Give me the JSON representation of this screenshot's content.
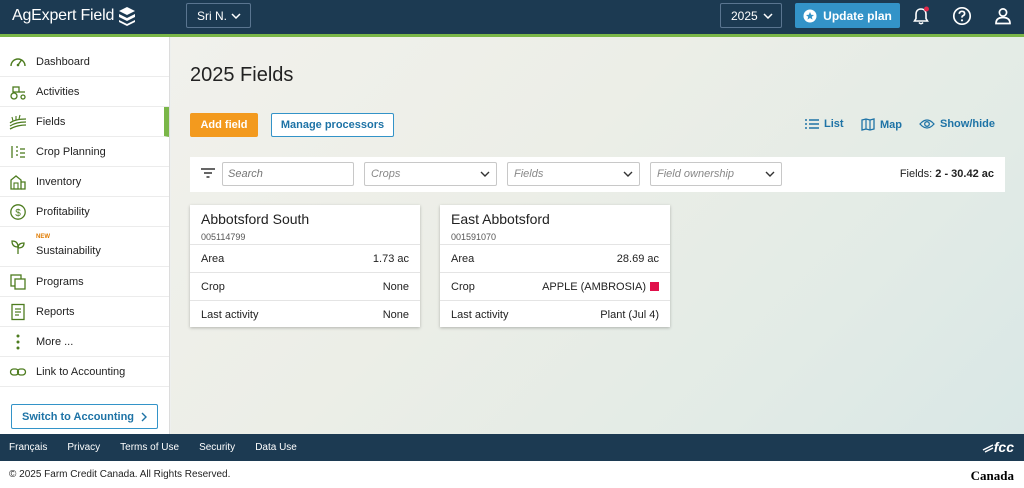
{
  "app": {
    "name": "AgExpert Field"
  },
  "header": {
    "user": "Sri N.",
    "year": "2025",
    "update_plan": "Update plan"
  },
  "sidebar": {
    "items": [
      {
        "label": "Dashboard",
        "icon": "gauge-icon"
      },
      {
        "label": "Activities",
        "icon": "tractor-icon"
      },
      {
        "label": "Fields",
        "icon": "field-rows-icon",
        "active": true
      },
      {
        "label": "Crop Planning",
        "icon": "crop-plan-icon"
      },
      {
        "label": "Inventory",
        "icon": "barn-icon"
      },
      {
        "label": "Profitability",
        "icon": "dollar-icon"
      },
      {
        "label": "Sustainability",
        "icon": "sprout-icon",
        "badge": "NEW"
      },
      {
        "label": "Programs",
        "icon": "programs-icon"
      },
      {
        "label": "Reports",
        "icon": "report-icon"
      },
      {
        "label": "More ...",
        "icon": "more-vertical-icon"
      },
      {
        "label": "Link to Accounting",
        "icon": "link-icon"
      }
    ],
    "switch_label": "Switch to Accounting"
  },
  "main": {
    "title": "2025 Fields",
    "add_field": "Add field",
    "manage_processors": "Manage processors",
    "views": {
      "list": "List",
      "map": "Map",
      "showhide": "Show/hide"
    },
    "filters": {
      "search_placeholder": "Search",
      "crops": "Crops",
      "fields": "Fields",
      "ownership": "Field ownership",
      "count_label": "Fields:",
      "count_value": "2 - 30.42 ac"
    },
    "cards": [
      {
        "name": "Abbotsford South",
        "id": "005114799",
        "area_label": "Area",
        "area": "1.73 ac",
        "crop_label": "Crop",
        "crop": "None",
        "activity_label": "Last activity",
        "activity": "None"
      },
      {
        "name": "East Abbotsford",
        "id": "001591070",
        "area_label": "Area",
        "area": "28.69 ac",
        "crop_label": "Crop",
        "crop": "APPLE (AMBROSIA)",
        "crop_color": "#e0104a",
        "activity_label": "Last activity",
        "activity": "Plant (Jul 4)"
      }
    ]
  },
  "footer": {
    "links": [
      "Français",
      "Privacy",
      "Terms of Use",
      "Security",
      "Data Use"
    ],
    "brand": "fcc",
    "copyright": "© 2025 Farm Credit Canada. All Rights Reserved.",
    "gov_wordmark": "Canada"
  },
  "colors": {
    "nav": "#1c3a52",
    "accent_green": "#7ab648",
    "primary_blue": "#3393c8",
    "orange": "#f39a1e"
  }
}
